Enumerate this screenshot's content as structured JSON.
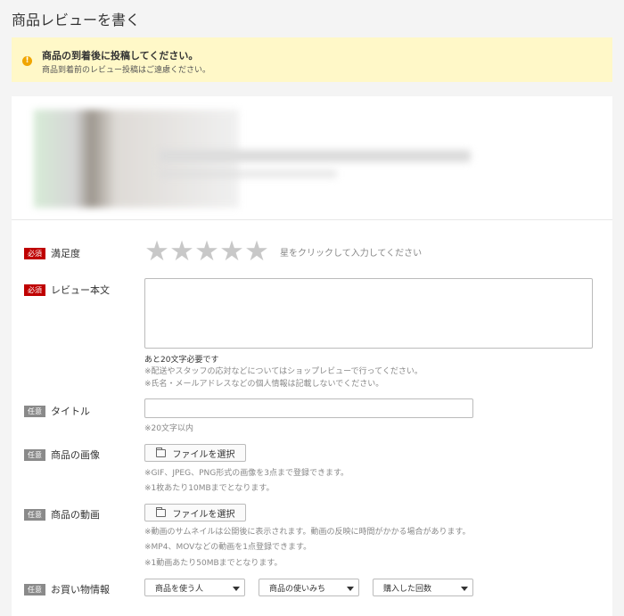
{
  "page": {
    "title": "商品レビューを書く"
  },
  "notice": {
    "icon": "info-icon",
    "main": "商品の到着後に投稿してください。",
    "sub": "商品到着前のレビュー投稿はご遠慮ください。"
  },
  "form": {
    "satisfaction": {
      "badge": "必須",
      "label": "満足度",
      "star_hint": "星をクリックして入力してください",
      "stars": [
        "★",
        "★",
        "★",
        "★",
        "★"
      ]
    },
    "review_body": {
      "badge": "必須",
      "label": "レビュー本文",
      "value": "",
      "remaining": "あと20文字必要です",
      "note1": "※配送やスタッフの応対などについてはショップレビューで行ってください。",
      "note2": "※氏名・メールアドレスなどの個人情報は記載しないでください。"
    },
    "title": {
      "badge": "任意",
      "label": "タイトル",
      "value": "",
      "note": "※20文字以内"
    },
    "image": {
      "badge": "任意",
      "label": "商品の画像",
      "button": "ファイルを選択",
      "note1": "※GIF、JPEG、PNG形式の画像を3点まで登録できます。",
      "note2": "※1枚あたり10MBまでとなります。"
    },
    "video": {
      "badge": "任意",
      "label": "商品の動画",
      "button": "ファイルを選択",
      "note1": "※動画のサムネイルは公開後に表示されます。動画の反映に時間がかかる場合があります。",
      "note2": "※MP4、MOVなどの動画を1点登録できます。",
      "note3": "※1動画あたり50MBまでとなります。"
    },
    "purchase_info": {
      "badge": "任意",
      "label": "お買い物情報",
      "selects": [
        "商品を使う人",
        "商品の使いみち",
        "購入した回数"
      ]
    }
  }
}
